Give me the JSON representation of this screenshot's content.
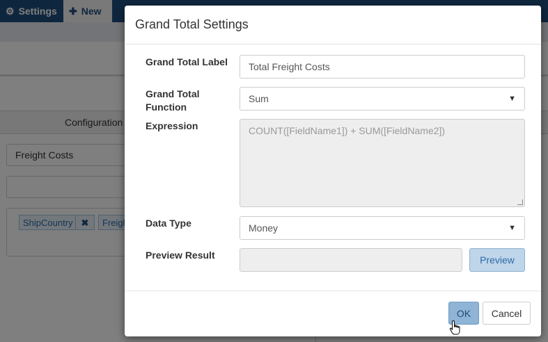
{
  "topbar": {
    "settings_label": "Settings",
    "new_label": "New"
  },
  "background": {
    "tab_configuration": "Configuration",
    "tab_right_partial": "e",
    "input_value": "Freight Costs",
    "chips": [
      "ShipCountry",
      "Freigh"
    ]
  },
  "dialog": {
    "title": "Grand Total Settings",
    "label_field": {
      "label": "Grand Total Label",
      "value": "Total Freight Costs"
    },
    "function_field": {
      "label": "Grand Total Function",
      "value": "Sum"
    },
    "expression_field": {
      "label": "Expression",
      "placeholder": "COUNT([FieldName1]) + SUM([FieldName2])"
    },
    "data_type_field": {
      "label": "Data Type",
      "value": "Money"
    },
    "preview_field": {
      "label": "Preview Result",
      "value": "",
      "button_label": "Preview"
    },
    "ok_label": "OK",
    "cancel_label": "Cancel"
  }
}
